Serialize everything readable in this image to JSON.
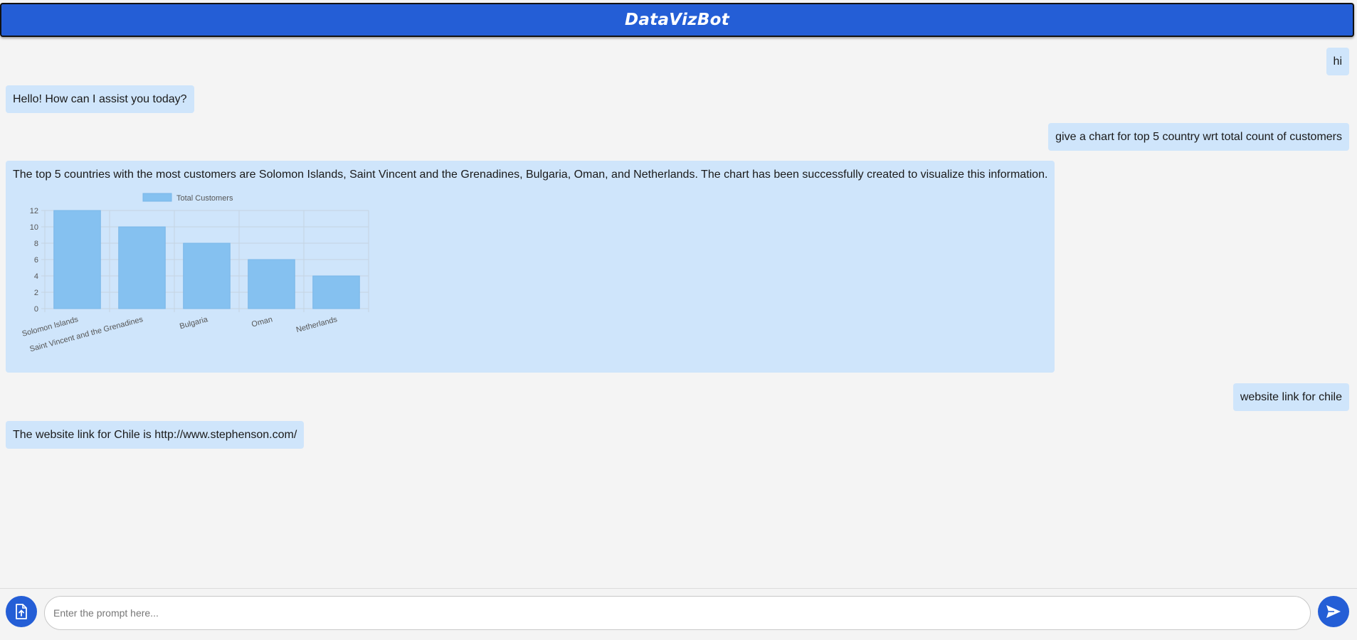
{
  "app": {
    "title": "DataVizBot"
  },
  "messages": [
    {
      "role": "user",
      "text": "hi"
    },
    {
      "role": "bot",
      "text": "Hello! How can I assist you today?"
    },
    {
      "role": "user",
      "text": "give a chart for top 5 country wrt total count of customers"
    },
    {
      "role": "bot",
      "text": "The top 5 countries with the most customers are Solomon Islands, Saint Vincent and the Grenadines, Bulgaria, Oman, and Netherlands. The chart has been successfully created to visualize this information."
    },
    {
      "role": "user",
      "text": "website link for chile"
    },
    {
      "role": "bot",
      "text": "The website link for Chile is http://www.stephenson.com/"
    }
  ],
  "chart_data": {
    "type": "bar",
    "categories": [
      "Solomon Islands",
      "Saint Vincent and the Grenadines",
      "Bulgaria",
      "Oman",
      "Netherlands"
    ],
    "series": [
      {
        "name": "Total Customers",
        "values": [
          12,
          10,
          8,
          6,
          4
        ]
      }
    ],
    "ylim": [
      0,
      12
    ],
    "yticks": [
      "0",
      "2",
      "4",
      "6",
      "8",
      "10",
      "12"
    ],
    "legend_position": "top",
    "grid": true,
    "bar_color": "#85c1f0"
  },
  "composer": {
    "placeholder": "Enter the prompt here...",
    "upload_icon": "file-upload-icon",
    "send_icon": "send-icon"
  },
  "colors": {
    "accent": "#245ed6",
    "bubble": "#cfe5fb",
    "background": "#f4f4f4"
  }
}
